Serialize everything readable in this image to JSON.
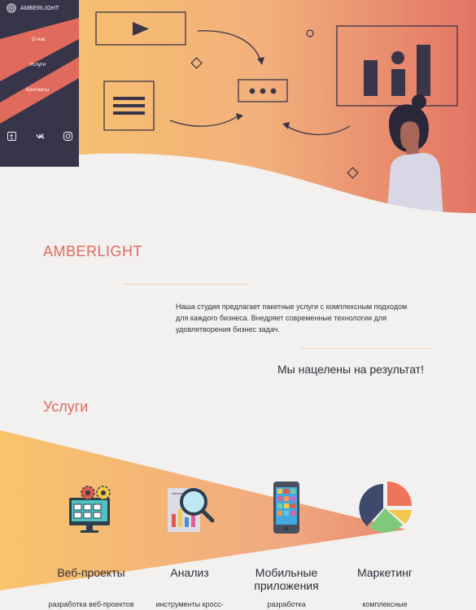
{
  "brand": {
    "name": "AMBERLIGHT",
    "logo_icon": "spiral-logo-icon"
  },
  "nav": {
    "items": [
      {
        "label": "О нас"
      },
      {
        "label": "Услуги"
      },
      {
        "label": "Контакты"
      }
    ]
  },
  "social": [
    {
      "icon": "tumblr-icon"
    },
    {
      "icon": "vk-icon"
    },
    {
      "icon": "instagram-icon"
    }
  ],
  "about": {
    "title": "AMBERLIGHT",
    "description": "Наша студия предлагает пакетные услуги с комплексным подходом для каждого бизнеса. Внедряет современные технологии для удовлетворения бизнес задач.",
    "tagline": "Мы нацелены на результат!"
  },
  "services": {
    "title": "Услуги",
    "items": [
      {
        "name": "Веб-проекты",
        "sub": "разработка веб-проектов",
        "icon": "monitor-gears-icon"
      },
      {
        "name": "Анализ",
        "sub": "инструменты кросс-",
        "icon": "magnifier-chart-icon"
      },
      {
        "name": "Мобильные приложения",
        "sub": "разработка",
        "icon": "smartphone-icon"
      },
      {
        "name": "Маркетинг",
        "sub": "комплексные",
        "icon": "pie-chart-icon"
      }
    ]
  },
  "colors": {
    "accent": "#e06a5b",
    "dark": "#37354a",
    "amber": "#f7c06a",
    "coral": "#e07060",
    "background": "#f3f0f0"
  }
}
